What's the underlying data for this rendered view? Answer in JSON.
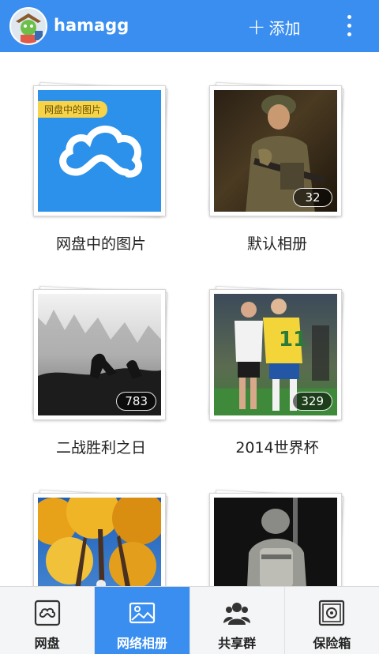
{
  "header": {
    "username": "hamagg",
    "add_label": "添加",
    "accent_color": "#3a8ef0"
  },
  "albums": [
    {
      "name": "网盘中的图片",
      "badge": "网盘中的图片",
      "icon": "cloud-icon"
    },
    {
      "name": "默认相册",
      "count": "32"
    },
    {
      "name": "二战胜利之日",
      "count": "783"
    },
    {
      "name": "2014世界杯",
      "count": "329"
    },
    {
      "name": ""
    },
    {
      "name": ""
    }
  ],
  "tabs": [
    {
      "label": "网盘",
      "icon": "cloud-drive-icon"
    },
    {
      "label": "网络相册",
      "icon": "photo-album-icon",
      "active": true
    },
    {
      "label": "共享群",
      "icon": "group-icon"
    },
    {
      "label": "保险箱",
      "icon": "safe-icon"
    }
  ]
}
